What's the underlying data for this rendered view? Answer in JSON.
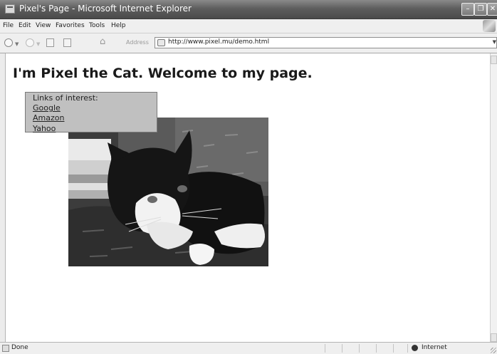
{
  "window": {
    "title": "Pixel's Page - Microsoft Internet Explorer",
    "minimize_icon": "minimize-icon",
    "maximize_icon": "maximize-icon",
    "close_icon": "close-icon"
  },
  "menubar": {
    "items": [
      "File",
      "Edit",
      "View",
      "Favorites",
      "Tools",
      "Help"
    ]
  },
  "toolbar": {
    "address_label": "Address",
    "address_value": "http://www.pixel.mu/demo.html",
    "icons": [
      "back-icon",
      "forward-icon",
      "stop-icon",
      "refresh-icon",
      "home-icon"
    ]
  },
  "page": {
    "heading": "I'm Pixel the Cat. Welcome to my page.",
    "links_label": "Links of interest:",
    "links": [
      "Google",
      "Amazon",
      "Yahoo"
    ]
  },
  "statusbar": {
    "status_text": "Done",
    "zone_text": "Internet"
  },
  "colors": {
    "titlebar": "#5e5e5e",
    "chrome": "#efefef",
    "links_box_bg": "#c0c0c0"
  }
}
